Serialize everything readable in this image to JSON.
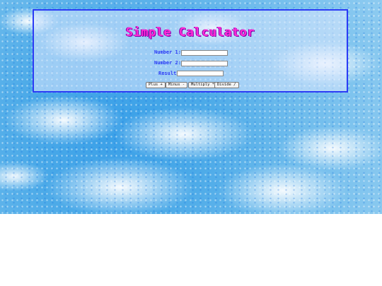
{
  "calculator": {
    "title": "Simple Calculator",
    "number1_label": "Number 1:",
    "number2_label": "Number 2:",
    "result_label": "Result:",
    "number1_value": "",
    "number2_value": "",
    "result_value": "",
    "buttons": {
      "plus": "Plus +",
      "minus": "Minus -",
      "multiply": "Multiply *",
      "divide": "Divide /"
    }
  },
  "colors": {
    "title": "#ff2bd6",
    "labels": "#2b3bf5",
    "panel_border": "#2b3bf5"
  }
}
